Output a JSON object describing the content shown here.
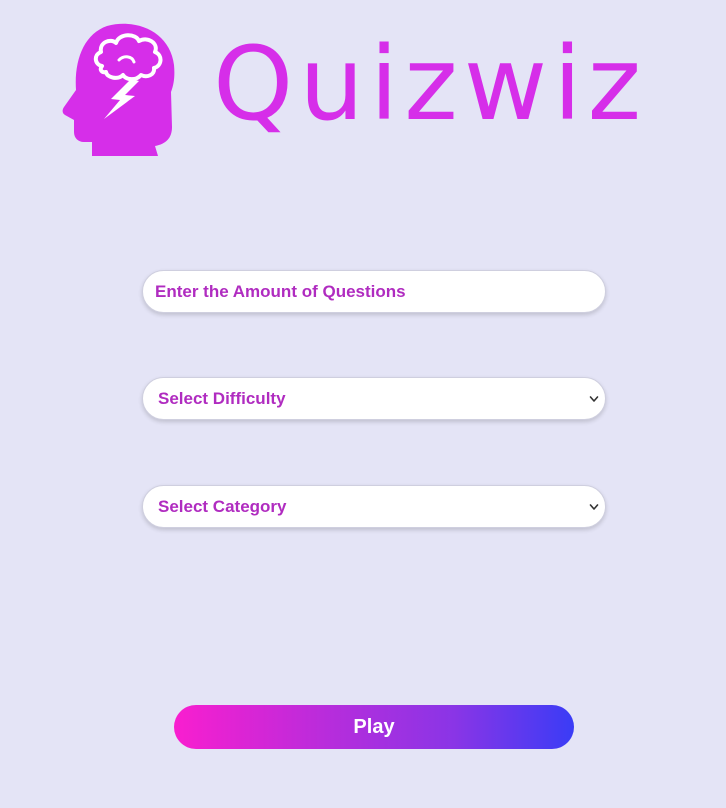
{
  "brand": {
    "name": "Quizwiz",
    "icon": "brain-head-lightning-icon",
    "color": "#d62ee9"
  },
  "form": {
    "amount_placeholder": "Enter the Amount of Questions",
    "difficulty_label": "Select Difficulty",
    "category_label": "Select Category",
    "chevron_icon": "chevron-down-icon",
    "text_color": "#b02cc0"
  },
  "play": {
    "label": "Play",
    "gradient": [
      "#f91ecf",
      "#3a3cf6"
    ]
  },
  "colors": {
    "background": "#e4e4f6"
  }
}
